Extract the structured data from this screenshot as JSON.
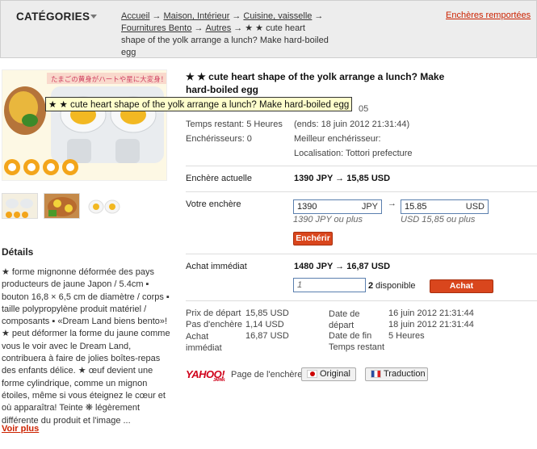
{
  "header": {
    "categories_label": "CATÉGORIES",
    "breadcrumb": [
      {
        "label": "Accueil",
        "link": true
      },
      {
        "label": "Maison, Intérieur",
        "link": true
      },
      {
        "label": "Cuisine, vaisselle",
        "link": true
      },
      {
        "label": "Fournitures Bento",
        "link": true
      },
      {
        "label": "Autres",
        "link": true
      },
      {
        "label": "★ ★ cute heart shape of the yolk arrange a lunch? Make hard-boiled egg",
        "link": false
      }
    ],
    "closed_auctions_link": "Enchères remportées"
  },
  "product": {
    "title": "★ ★ cute heart shape of the yolk arrange a lunch? Make hard-boiled egg",
    "tooltip": "★ ★ cute heart shape of the yolk arrange a lunch? Make hard-boiled egg",
    "ref_partial": "05",
    "image_caption": "たまごの黄身がハートや星に大変身！",
    "info": {
      "time_left_label": "Temps restant: 5 Heures",
      "ends": "(ends: 18 juin 2012 21:31:44)",
      "bidders_label": "Enchérisseurs: 0",
      "best_bidder": "Meilleur enchérisseur:",
      "location": "Localisation: Tottori prefecture"
    },
    "current_bid": {
      "label": "Enchère actuelle",
      "value": "1390 JPY → 15,85 USD"
    },
    "your_bid": {
      "label": "Votre enchère",
      "jpy_value": "1390",
      "jpy_unit": "JPY",
      "usd_value": "15.85",
      "usd_unit": "USD",
      "arrow": "→",
      "jpy_hint": "1390 JPY ou plus",
      "usd_hint": "USD 15,85 ou plus",
      "bid_button": "Enchérir"
    },
    "buy_now": {
      "label": "Achat immédiat",
      "price": "1480 JPY → 16,87 USD",
      "qty_value": "1",
      "available_count": "2",
      "available_label": "disponible",
      "button": "Achat immédiat"
    },
    "summary": {
      "start_price_label": "Prix de départ",
      "start_price": "15,85 USD",
      "bid_step_label": "Pas d'enchère",
      "bid_step": "1,14 USD",
      "buy_label": "Achat immédiat",
      "buy_value": "16,87 USD",
      "start_date_label": "Date de départ",
      "start_date": "16 juin 2012 21:31:44",
      "end_date_label": "Date de fin",
      "end_date": "18 juin 2012 21:31:44",
      "time_left_label": "Temps restant",
      "time_left": "5 Heures"
    },
    "page_label": "Page de l'enchère",
    "original_button": "Original",
    "translation_button": "Traduction",
    "yahoo_logo": "YAHOO!",
    "yahoo_sub": "JAPAN"
  },
  "details": {
    "heading": "Détails",
    "description": "★ forme mignonne déformée des pays producteurs de jaune Japon / 5.4cm ▪ bouton 16,8 × 6,5 cm de diamètre / corps ▪ taille polypropylène produit matériel / composants ▪ «Dream Land biens bento»! ★ peut déformer la forme du jaune comme vous le voir avec le Dream Land, contribuera à faire de jolies boîtes-repas des enfants délice. ★ œuf devient une forme cylindrique, comme un mignon étoiles, même si vous éteignez le cœur et où apparaîtra! Teinte ❋ légèrement différente du produit et l'image ...",
    "more_link": "Voir plus"
  },
  "colors": {
    "accent_red": "#cc2200",
    "button_red": "#d9461d",
    "input_border": "#5a7fae"
  }
}
